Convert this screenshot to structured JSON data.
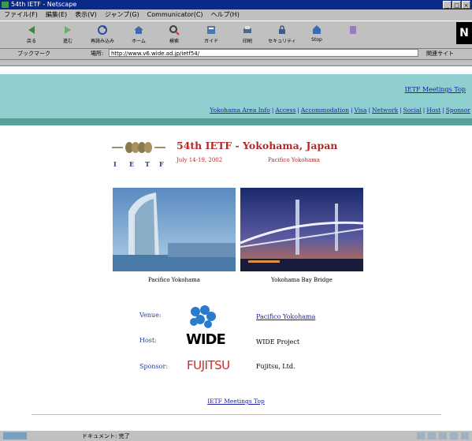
{
  "window": {
    "title": "54th IETF - Netscape"
  },
  "menu": [
    "ファイル(F)",
    "編集(E)",
    "表示(V)",
    "ジャンプ(G)",
    "Communicator(C)",
    "ヘルプ(H)"
  ],
  "toolbar": [
    {
      "label": "戻る",
      "icon": "back-arrow-icon"
    },
    {
      "label": "進む",
      "icon": "forward-arrow-icon"
    },
    {
      "label": "再読み込み",
      "icon": "reload-icon"
    },
    {
      "label": "ホーム",
      "icon": "home-icon"
    },
    {
      "label": "検索",
      "icon": "search-icon"
    },
    {
      "label": "ガイド",
      "icon": "guide-icon"
    },
    {
      "label": "印刷",
      "icon": "print-icon"
    },
    {
      "label": "セキュリティ",
      "icon": "security-icon"
    },
    {
      "label": "Stop",
      "icon": "stop-icon"
    }
  ],
  "location": {
    "bookmarks_label": "ブックマーク",
    "label": "場所:",
    "url": "http://www.v6.wide.ad.jp/ietf54/",
    "related_label": "関連サイト"
  },
  "page": {
    "top_link": "IETF Meetings Top",
    "nav": [
      "Yokohama Area Info",
      "Access",
      "Accommodation",
      "Visa",
      "Network",
      "Social",
      "Host",
      "Sponsor"
    ],
    "event_title": "54th IETF - Yokohama, Japan",
    "event_date": "July 14-19, 2002",
    "event_place": "Pacifico Yokohama",
    "photo_left_caption": "Pacifico Yokohama",
    "photo_right_caption": "Yokohama Bay Bridge",
    "rows": {
      "venue_label": "Venue:",
      "venue_value": "Pacifico Yokohama",
      "host_label": "Host:",
      "host_value": "WIDE Project",
      "sponsor_label": "Sponsor:",
      "sponsor_value": "Fujitsu, Ltd."
    },
    "host_logo_text": "WIDE",
    "sponsor_logo_text": "FUJITSU",
    "bottom_link": "IETF Meetings Top"
  },
  "status": {
    "text": "ドキュメント: 完了"
  },
  "colors": {
    "teal": "#8fcfcf",
    "dark_teal": "#5aa09a",
    "title_red": "#b02a2a",
    "link": "#2020a0"
  }
}
